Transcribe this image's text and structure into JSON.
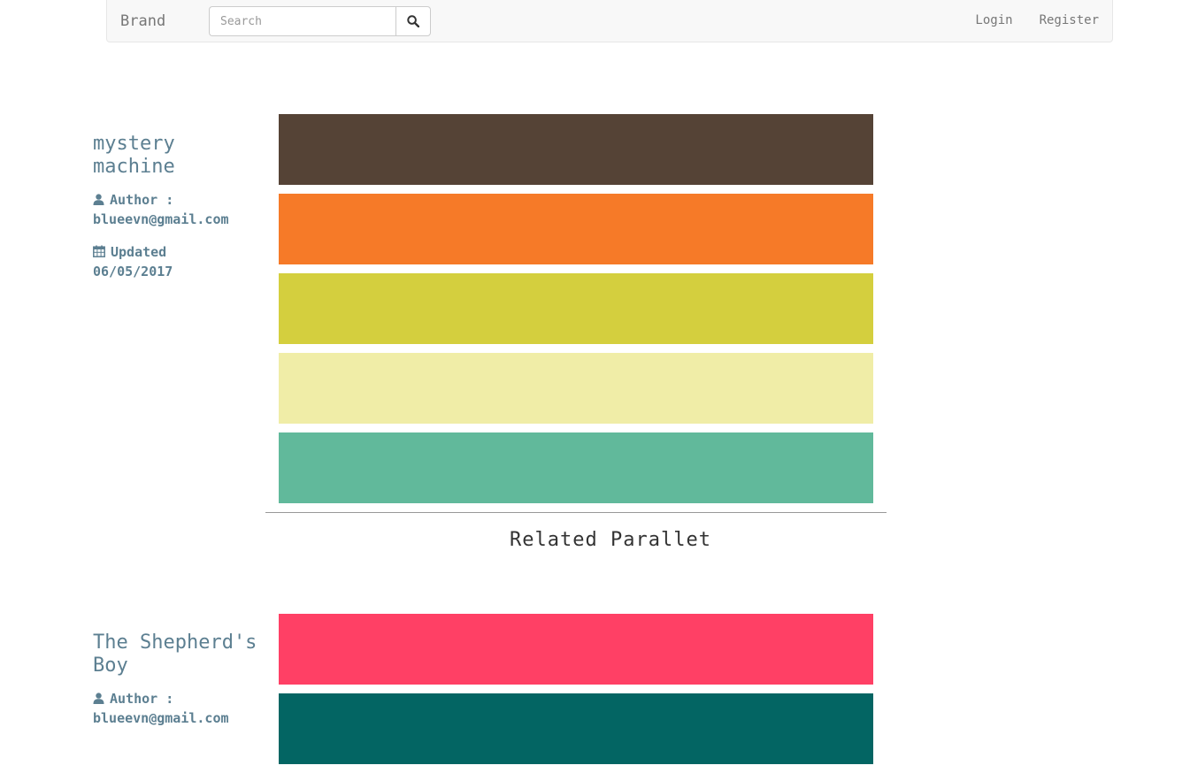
{
  "navbar": {
    "brand": "Brand",
    "search_placeholder": "Search",
    "search_icon": "magnifier-icon",
    "login": "Login",
    "register": "Register"
  },
  "palettes": [
    {
      "title": "mystery machine",
      "author_label": "Author :",
      "author": "blueevn@gmail.com",
      "updated_label": "Updated",
      "updated": "06/05/2017",
      "colors": [
        "#554336",
        "#f67a28",
        "#d4cf3e",
        "#f0eda7",
        "#61b99b"
      ]
    },
    {
      "title": "The Shepherd's Boy",
      "author_label": "Author :",
      "author": "blueevn@gmail.com",
      "colors": [
        "#ff4065",
        "#036563"
      ]
    }
  ],
  "related_heading": "Related Parallet"
}
